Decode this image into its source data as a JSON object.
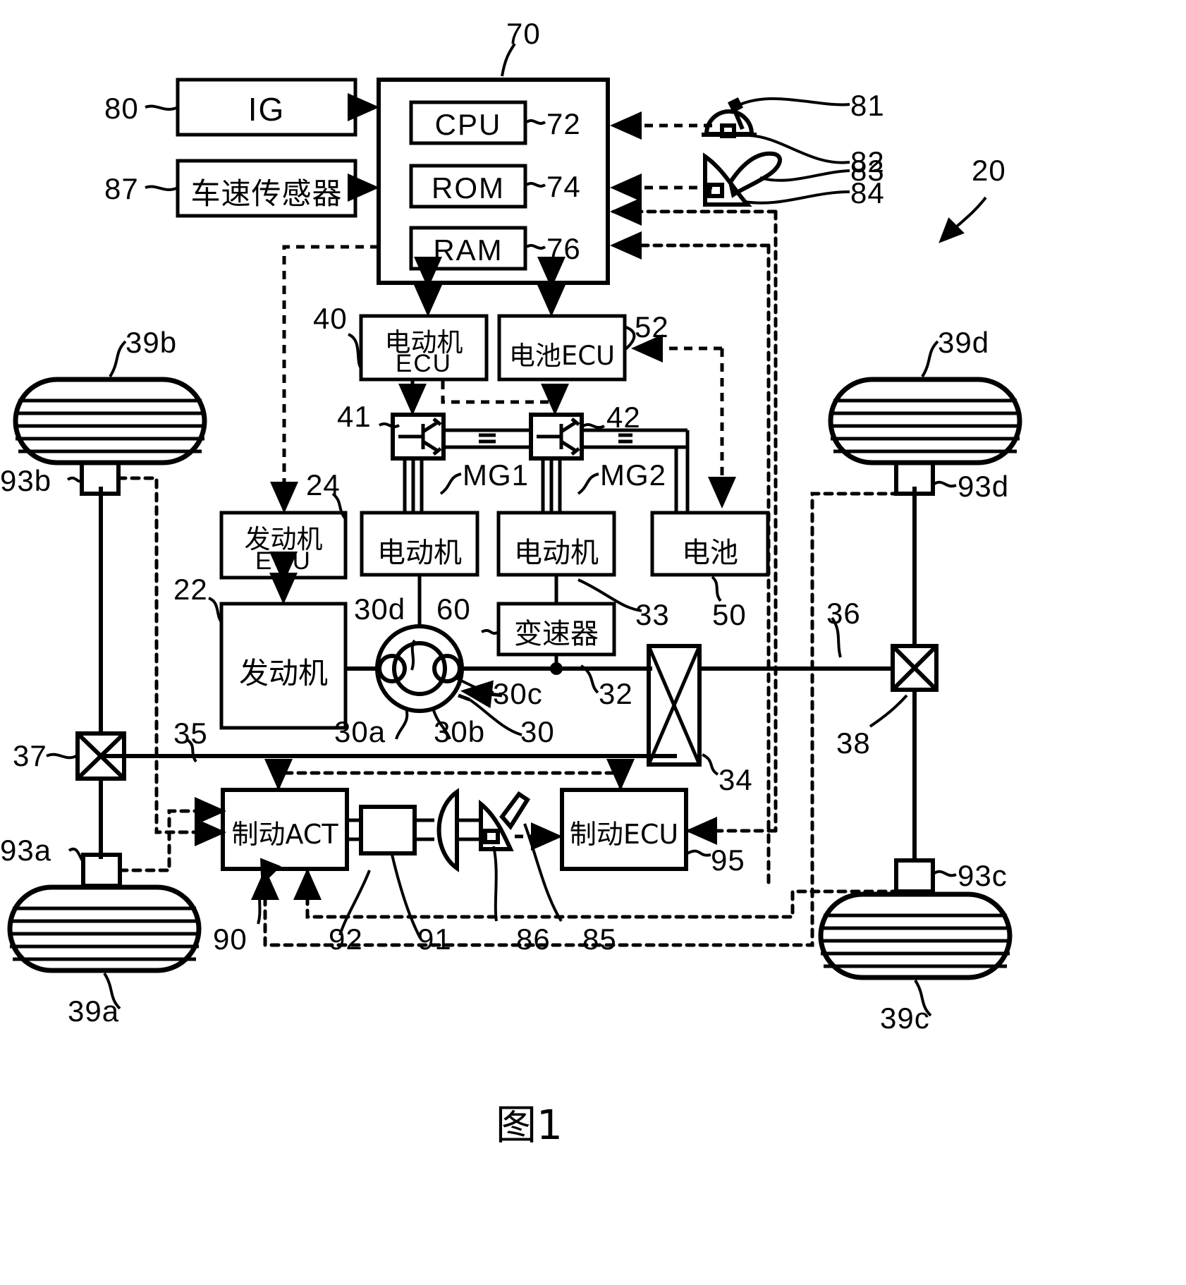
{
  "figure": {
    "caption": "图1",
    "caption_label": "图",
    "caption_number": "1"
  },
  "blocks": {
    "ig": {
      "label": "IG",
      "ref": "80"
    },
    "vehicle_speed_sensor": {
      "label": "车速传感器",
      "ref": "87"
    },
    "controller": {
      "ref": "70",
      "cpu": "CPU",
      "cpu_ref": "72",
      "rom": "ROM",
      "rom_ref": "74",
      "ram": "RAM",
      "ram_ref": "76"
    },
    "motor_ecu": {
      "label_line1": "电动机",
      "label_line2": "ECU",
      "ref": "40"
    },
    "battery_ecu": {
      "label": "电池ECU",
      "ref": "52"
    },
    "inverter1": {
      "ref": "41"
    },
    "inverter2": {
      "ref": "42"
    },
    "engine_ecu": {
      "label_line1": "发动机",
      "label_line2": "ECU",
      "ref": "24"
    },
    "engine": {
      "label": "发动机",
      "ref": "22"
    },
    "motor1": {
      "label": "电动机",
      "ref": "MG1"
    },
    "motor2": {
      "label": "电动机",
      "ref": "MG2"
    },
    "battery": {
      "label": "电池",
      "ref": "50"
    },
    "transmission": {
      "label": "变速器",
      "ref": "60"
    },
    "brake_act": {
      "label": "制动ACT",
      "ref": "92"
    },
    "brake_ecu": {
      "label": "制动ECU",
      "ref": "95"
    },
    "master_cylinder": {
      "ref": "91"
    },
    "brake_pedal_sensor": {
      "ref": "86"
    },
    "brake_pedal": {
      "ref": "85"
    },
    "brake_system": {
      "ref": "90"
    }
  },
  "reference_numerals": {
    "system": "20",
    "planetary_carrier": "30a",
    "planetary_pinion": "30b",
    "planetary_ring": "30c",
    "planetary_sun": "30d",
    "planetary_gear": "30",
    "drive_shaft": "32",
    "reduction_gear": "33",
    "differential_rear": "34",
    "axle_front": "35",
    "axle_rear": "36",
    "diff_front": "37",
    "diff_rear": "38",
    "shift_sensor": "81",
    "shift_lever": "82",
    "accel_sensor": "83",
    "accel_pedal": "84"
  },
  "wheels": [
    {
      "ref": "39b",
      "sensor_ref": "93b"
    },
    {
      "ref": "39d",
      "sensor_ref": "93d"
    },
    {
      "ref": "39a",
      "sensor_ref": "93a"
    },
    {
      "ref": "39c",
      "sensor_ref": "93c"
    }
  ],
  "colors": {
    "ink": "#000000",
    "paper": "#ffffff"
  }
}
